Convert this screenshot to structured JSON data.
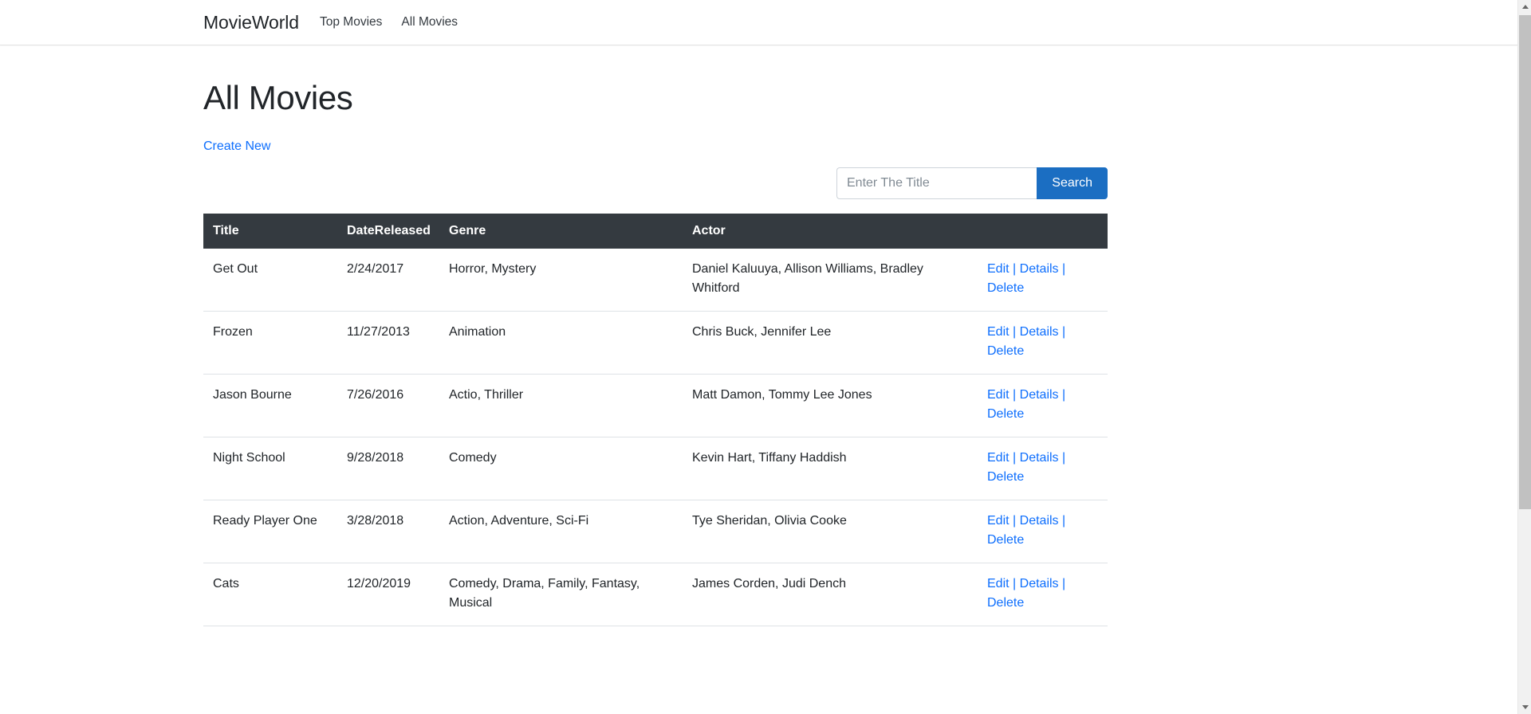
{
  "navbar": {
    "brand": "MovieWorld",
    "links": [
      {
        "label": "Top Movies"
      },
      {
        "label": "All Movies"
      }
    ]
  },
  "page": {
    "title": "All Movies",
    "create_new_label": "Create New"
  },
  "search": {
    "placeholder": "Enter The Title",
    "value": "",
    "button_label": "Search"
  },
  "table": {
    "headers": {
      "title": "Title",
      "date_released": "DateReleased",
      "genre": "Genre",
      "actor": "Actor",
      "actions": ""
    },
    "actions": {
      "edit": "Edit",
      "details": "Details",
      "delete": "Delete",
      "separator": "|"
    },
    "rows": [
      {
        "title": "Get Out",
        "date": "2/24/2017",
        "genre": "Horror, Mystery",
        "actor": "Daniel Kaluuya, Allison Williams, Bradley Whitford"
      },
      {
        "title": "Frozen",
        "date": "11/27/2013",
        "genre": "Animation",
        "actor": "Chris Buck, Jennifer Lee"
      },
      {
        "title": "Jason Bourne",
        "date": "7/26/2016",
        "genre": "Actio, Thriller",
        "actor": "Matt Damon, Tommy Lee Jones"
      },
      {
        "title": "Night School",
        "date": "9/28/2018",
        "genre": "Comedy",
        "actor": "Kevin Hart, Tiffany Haddish"
      },
      {
        "title": "Ready Player One",
        "date": "3/28/2018",
        "genre": "Action, Adventure, Sci-Fi",
        "actor": "Tye Sheridan, Olivia Cooke"
      },
      {
        "title": "Cats",
        "date": "12/20/2019",
        "genre": "Comedy, Drama, Family, Fantasy, Musical",
        "actor": "James Corden, Judi Dench"
      }
    ]
  },
  "colors": {
    "link": "#0d6efd",
    "primary_button": "#1b6ec2",
    "table_header_bg": "#343a40",
    "text": "#212529"
  }
}
